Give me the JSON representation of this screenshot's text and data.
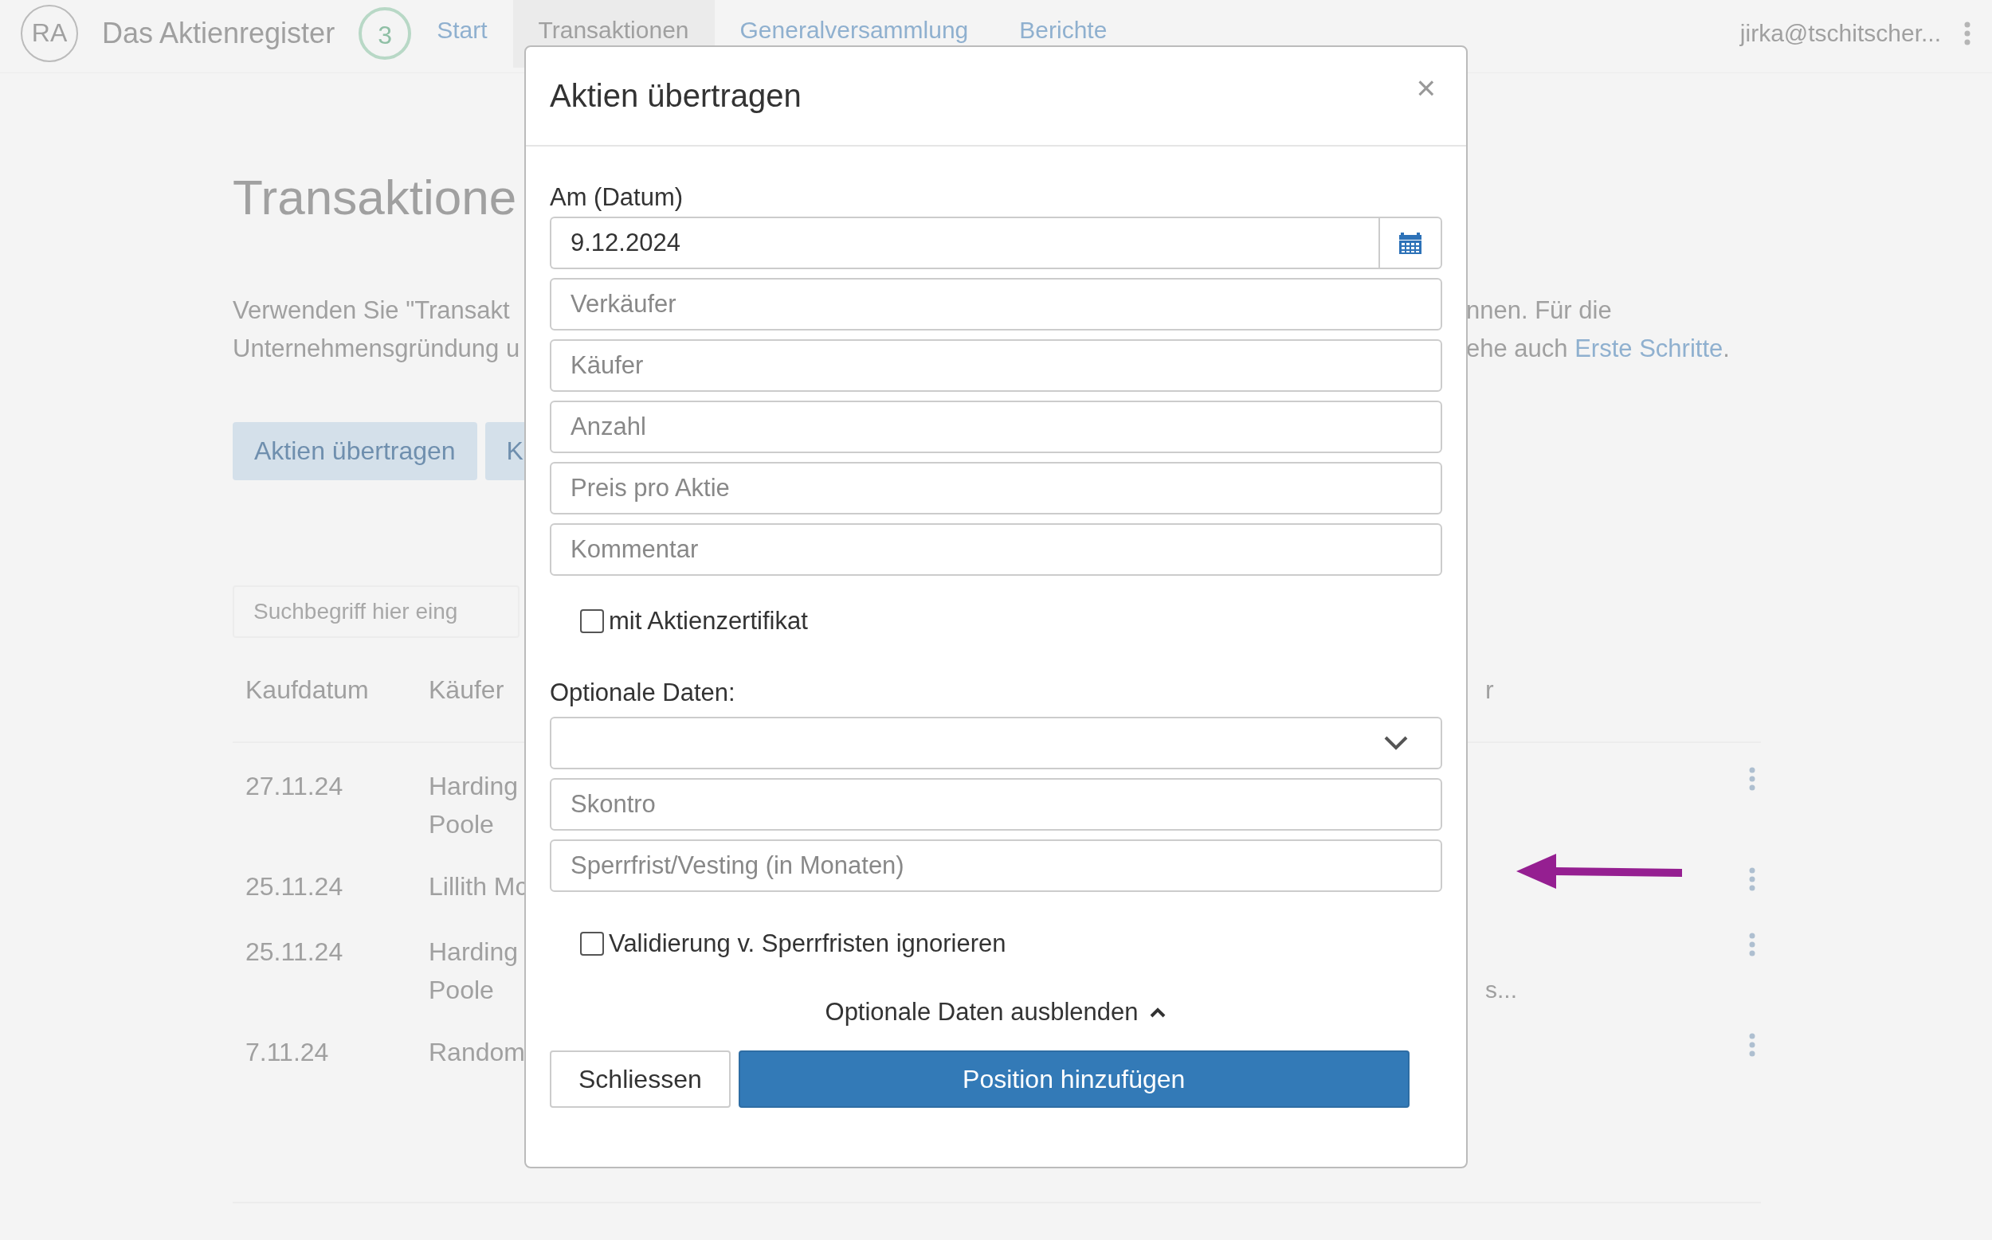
{
  "nav": {
    "logo": "RA",
    "title": "Das Aktienregister",
    "badge": "3",
    "tabs": [
      {
        "label": "Start",
        "selected": false
      },
      {
        "label": "Transaktionen",
        "selected": true
      },
      {
        "label": "Generalversammlung",
        "selected": false
      },
      {
        "label": "Berichte",
        "selected": false
      }
    ],
    "user": "jirka@tschitscher..."
  },
  "page": {
    "title": "Transaktione",
    "intro": [
      {
        "left": "Verwenden Sie \"Transakt",
        "right": "nnen. Für die"
      },
      {
        "left": "Unternehmensgründung u",
        "right": "ehe auch ",
        "link": "Erste Schritte",
        "after": "."
      }
    ],
    "buttons": [
      "Aktien übertragen",
      "K"
    ],
    "search": {
      "placeholder": "Suchbegriff hier eing"
    },
    "columns": [
      "Kaufdatum",
      "Käufer",
      "r"
    ],
    "rows": [
      {
        "date": "27.11.24",
        "buyer": "Harding Poole"
      },
      {
        "date": "25.11.24",
        "buyer": "Lillith Mc"
      },
      {
        "date": "25.11.24",
        "buyer": "Harding Poole",
        "column_3": "s..."
      },
      {
        "date": "7.11.24",
        "buyer": "Random"
      }
    ]
  },
  "dialog": {
    "title": "Aktien übertragen",
    "close": "×",
    "date_label": "Am (Datum)",
    "date_value": "9.12.2024",
    "fields": [
      {
        "placeholder": "Verkäufer"
      },
      {
        "placeholder": "Käufer"
      },
      {
        "placeholder": "Anzahl"
      },
      {
        "placeholder": "Preis pro Aktie"
      },
      {
        "placeholder": "Kommentar"
      }
    ],
    "certificate": {
      "label": "mit Aktienzertifikat",
      "checked": false
    },
    "optional_label": "Optionale Daten:",
    "optional_fields": [
      {
        "placeholder": "Skontro"
      },
      {
        "placeholder": "Sperrfrist/Vesting (in Monaten)"
      }
    ],
    "ignore": {
      "label": "Validierung v. Sperrfristen ignorieren",
      "checked": false
    },
    "toggle": "Optionale Daten ausblenden",
    "buttons": [
      {
        "label": "Schliessen",
        "kind": "default"
      },
      {
        "label": "Position hinzufügen",
        "kind": "primary"
      }
    ]
  }
}
